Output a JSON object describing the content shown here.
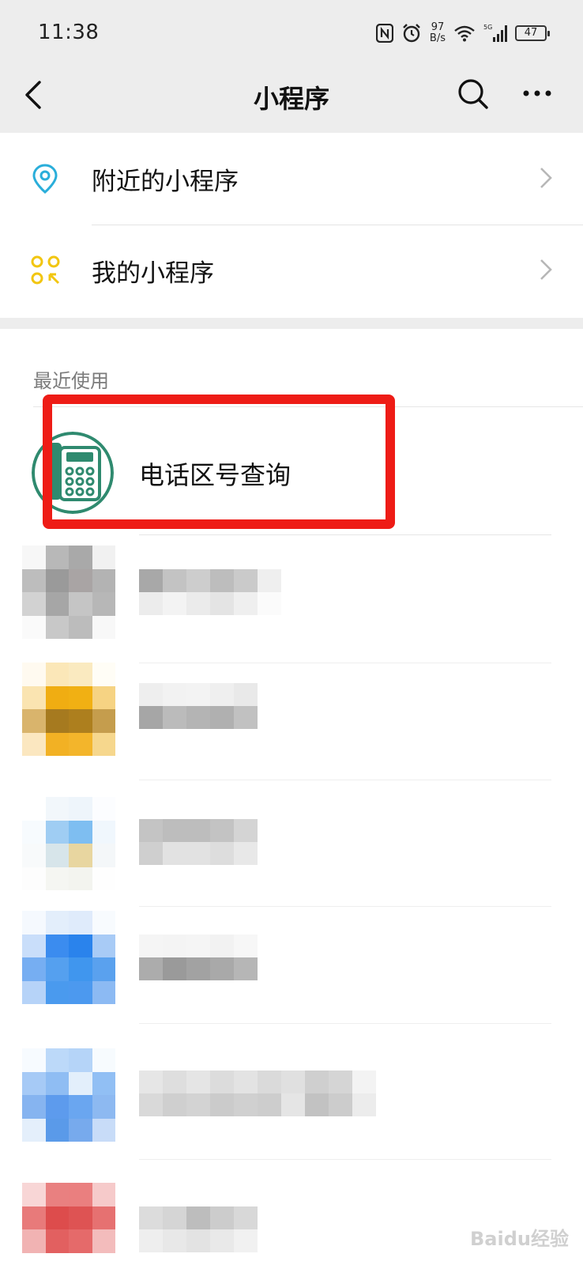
{
  "status_bar": {
    "time": "11:38",
    "net_speed_value": "97",
    "net_speed_unit": "B/s",
    "network_type": "5G",
    "battery": "47"
  },
  "nav": {
    "title": "小程序"
  },
  "menu": {
    "items": [
      {
        "label": "附近的小程序",
        "icon": "location-pin-icon",
        "icon_color": "#2aaeda"
      },
      {
        "label": "我的小程序",
        "icon": "mini-program-icon",
        "icon_color": "#f2c611"
      }
    ]
  },
  "recent": {
    "section_title": "最近使用",
    "items": [
      {
        "label": "电话区号查询",
        "icon": "phone-keypad-icon",
        "icon_color": "#2f8a6f"
      }
    ],
    "highlight_color": "#ee1c16"
  },
  "watermark": "Baidu经验"
}
